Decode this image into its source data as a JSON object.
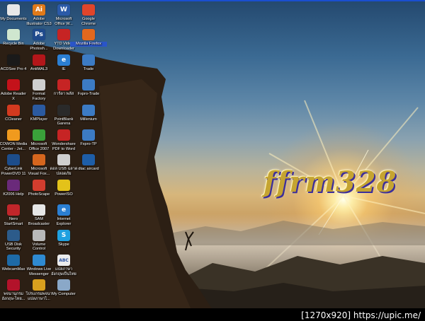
{
  "wallpaper_text": "ffrm328",
  "watermark": "[1270x920] https://upic.me/",
  "icons_col1": [
    {
      "label": "My Documents",
      "icon": "my-documents-icon",
      "color": "#e8e8e8"
    },
    {
      "label": "Recycle Bin",
      "icon": "recycle-bin-icon",
      "color": "#cfe6cf"
    },
    {
      "label": "ACDSee Pro 4",
      "icon": "acdsee-icon",
      "color": "#1a1a1a"
    },
    {
      "label": "Adobe Reader\n X",
      "icon": "adobe-reader-icon",
      "color": "#c4121a"
    },
    {
      "label": "CCleaner",
      "icon": "ccleaner-icon",
      "color": "#d33a1f"
    },
    {
      "label": "COWON Media\nCenter - Jet...",
      "icon": "cowon-icon",
      "color": "#f09a1e"
    },
    {
      "label": "CyberLink\nPowerDVD 11",
      "icon": "powerdvd-icon",
      "color": "#1d4d8b"
    },
    {
      "label": "K2006 Help",
      "icon": "k2006-help-icon",
      "color": "#6a2a7a"
    },
    {
      "label": "Nero\nStartSmart",
      "icon": "nero-icon",
      "color": "#c0262a"
    },
    {
      "label": "USB Disk\nSecurity",
      "icon": "usb-disk-security-icon",
      "color": "#2c5b8a"
    },
    {
      "label": "WebcamMax",
      "icon": "webcammax-icon",
      "color": "#1e6aa6"
    },
    {
      "label": "พจนานุกรม\nอังกฤษ-ไทย...",
      "icon": "dictionary-icon",
      "color": "#b3122a"
    }
  ],
  "icons_col2": [
    {
      "label": "Adobe\nIllustrator CS3",
      "icon": "illustrator-icon",
      "color": "#e07a1a",
      "text": "Ai"
    },
    {
      "label": "Adobe\nPhotosh...",
      "icon": "photoshop-icon",
      "color": "#1f4a8c",
      "text": "Ps"
    },
    {
      "label": "AntiMAL3",
      "icon": "antimal-icon",
      "color": "#b3161a"
    },
    {
      "label": "Format\nFactory",
      "icon": "format-factory-icon",
      "color": "#cfcfcf"
    },
    {
      "label": "KMPlayer",
      "icon": "kmplayer-icon",
      "color": "#2b5aa0"
    },
    {
      "label": "Microsoft\nOffice 2007",
      "icon": "office-2007-icon",
      "color": "#3aa13a"
    },
    {
      "label": "Microsoft\nVisual Fox...",
      "icon": "visual-foxpro-icon",
      "color": "#d5661e"
    },
    {
      "label": "PhotoScape",
      "icon": "photoscape-icon",
      "color": "#d23d2e"
    },
    {
      "label": "SAM\nBroadcaster",
      "icon": "sam-broadcaster-icon",
      "color": "#e6e6e6"
    },
    {
      "label": "Volume\nControl",
      "icon": "volume-control-icon",
      "color": "#b9b9b9"
    },
    {
      "label": "Windows Live\nMessenger",
      "icon": "messenger-icon",
      "color": "#2f8ad1"
    },
    {
      "label": "โปรแกรมพจนา\nแปลภาษาไ...",
      "icon": "translator-icon",
      "color": "#d9a01e"
    }
  ],
  "icons_col3": [
    {
      "label": "Microsoft\nOffice W...",
      "icon": "office-word-icon",
      "color": "#2b5aa8",
      "text": "W"
    },
    {
      "label": "YTD Video\nDownloader",
      "icon": "ytd-icon",
      "color": "#c62424"
    },
    {
      "label": "IE",
      "icon": "ie-icon",
      "color": "#2b7fd3",
      "text": "e"
    },
    {
      "label": "การ์ดา พลัส",
      "icon": "card-plus-icon",
      "color": "#c62424"
    },
    {
      "label": "PointBlank\nGarena",
      "icon": "pointblank-icon",
      "color": "#2a2a2a"
    },
    {
      "label": "Wondershare\nPDF to Word",
      "icon": "pdf-to-word-icon",
      "color": "#c62424"
    },
    {
      "label": "ดอล USB ฉลาด\nปลอดภัย",
      "icon": "usb-tool-icon",
      "color": "#cfcfcf"
    },
    {
      "label": "PowerISO",
      "icon": "poweriso-icon",
      "color": "#e3c21a"
    },
    {
      "label": "Internet\nExplorer",
      "icon": "internet-explorer-icon",
      "color": "#2b7fd3",
      "text": "e"
    },
    {
      "label": "Skype",
      "icon": "skype-icon",
      "color": "#1fa0e0",
      "text": "S"
    },
    {
      "label": "แปลภาษา\nอังกฤษเป็นไทย",
      "icon": "abc-icon",
      "color": "#ececec",
      "text": "ABC"
    },
    {
      "label": "My Computer",
      "icon": "my-computer-icon",
      "color": "#8aa8c8"
    }
  ],
  "icons_col4": [
    {
      "label": "Google\nChrome",
      "icon": "chrome-icon",
      "color": "#e0452b"
    },
    {
      "label": "Mozilla Firefox",
      "icon": "firefox-icon",
      "color": "#e2681e",
      "selected": true
    },
    {
      "label": "Trade",
      "icon": "trade-icon",
      "color": "#3c7bc4"
    },
    {
      "label": "Fxpro-Trade",
      "icon": "fxpro-trade-icon",
      "color": "#3c7bc4"
    },
    {
      "label": "Millenium",
      "icon": "millenium-icon",
      "color": "#3c7bc4"
    },
    {
      "label": "Fxpro-TP",
      "icon": "fxpro-tp-icon",
      "color": "#3c7bc4"
    },
    {
      "label": "dtac aircard",
      "icon": "dtac-aircard-icon",
      "color": "#1e5ea8"
    }
  ]
}
